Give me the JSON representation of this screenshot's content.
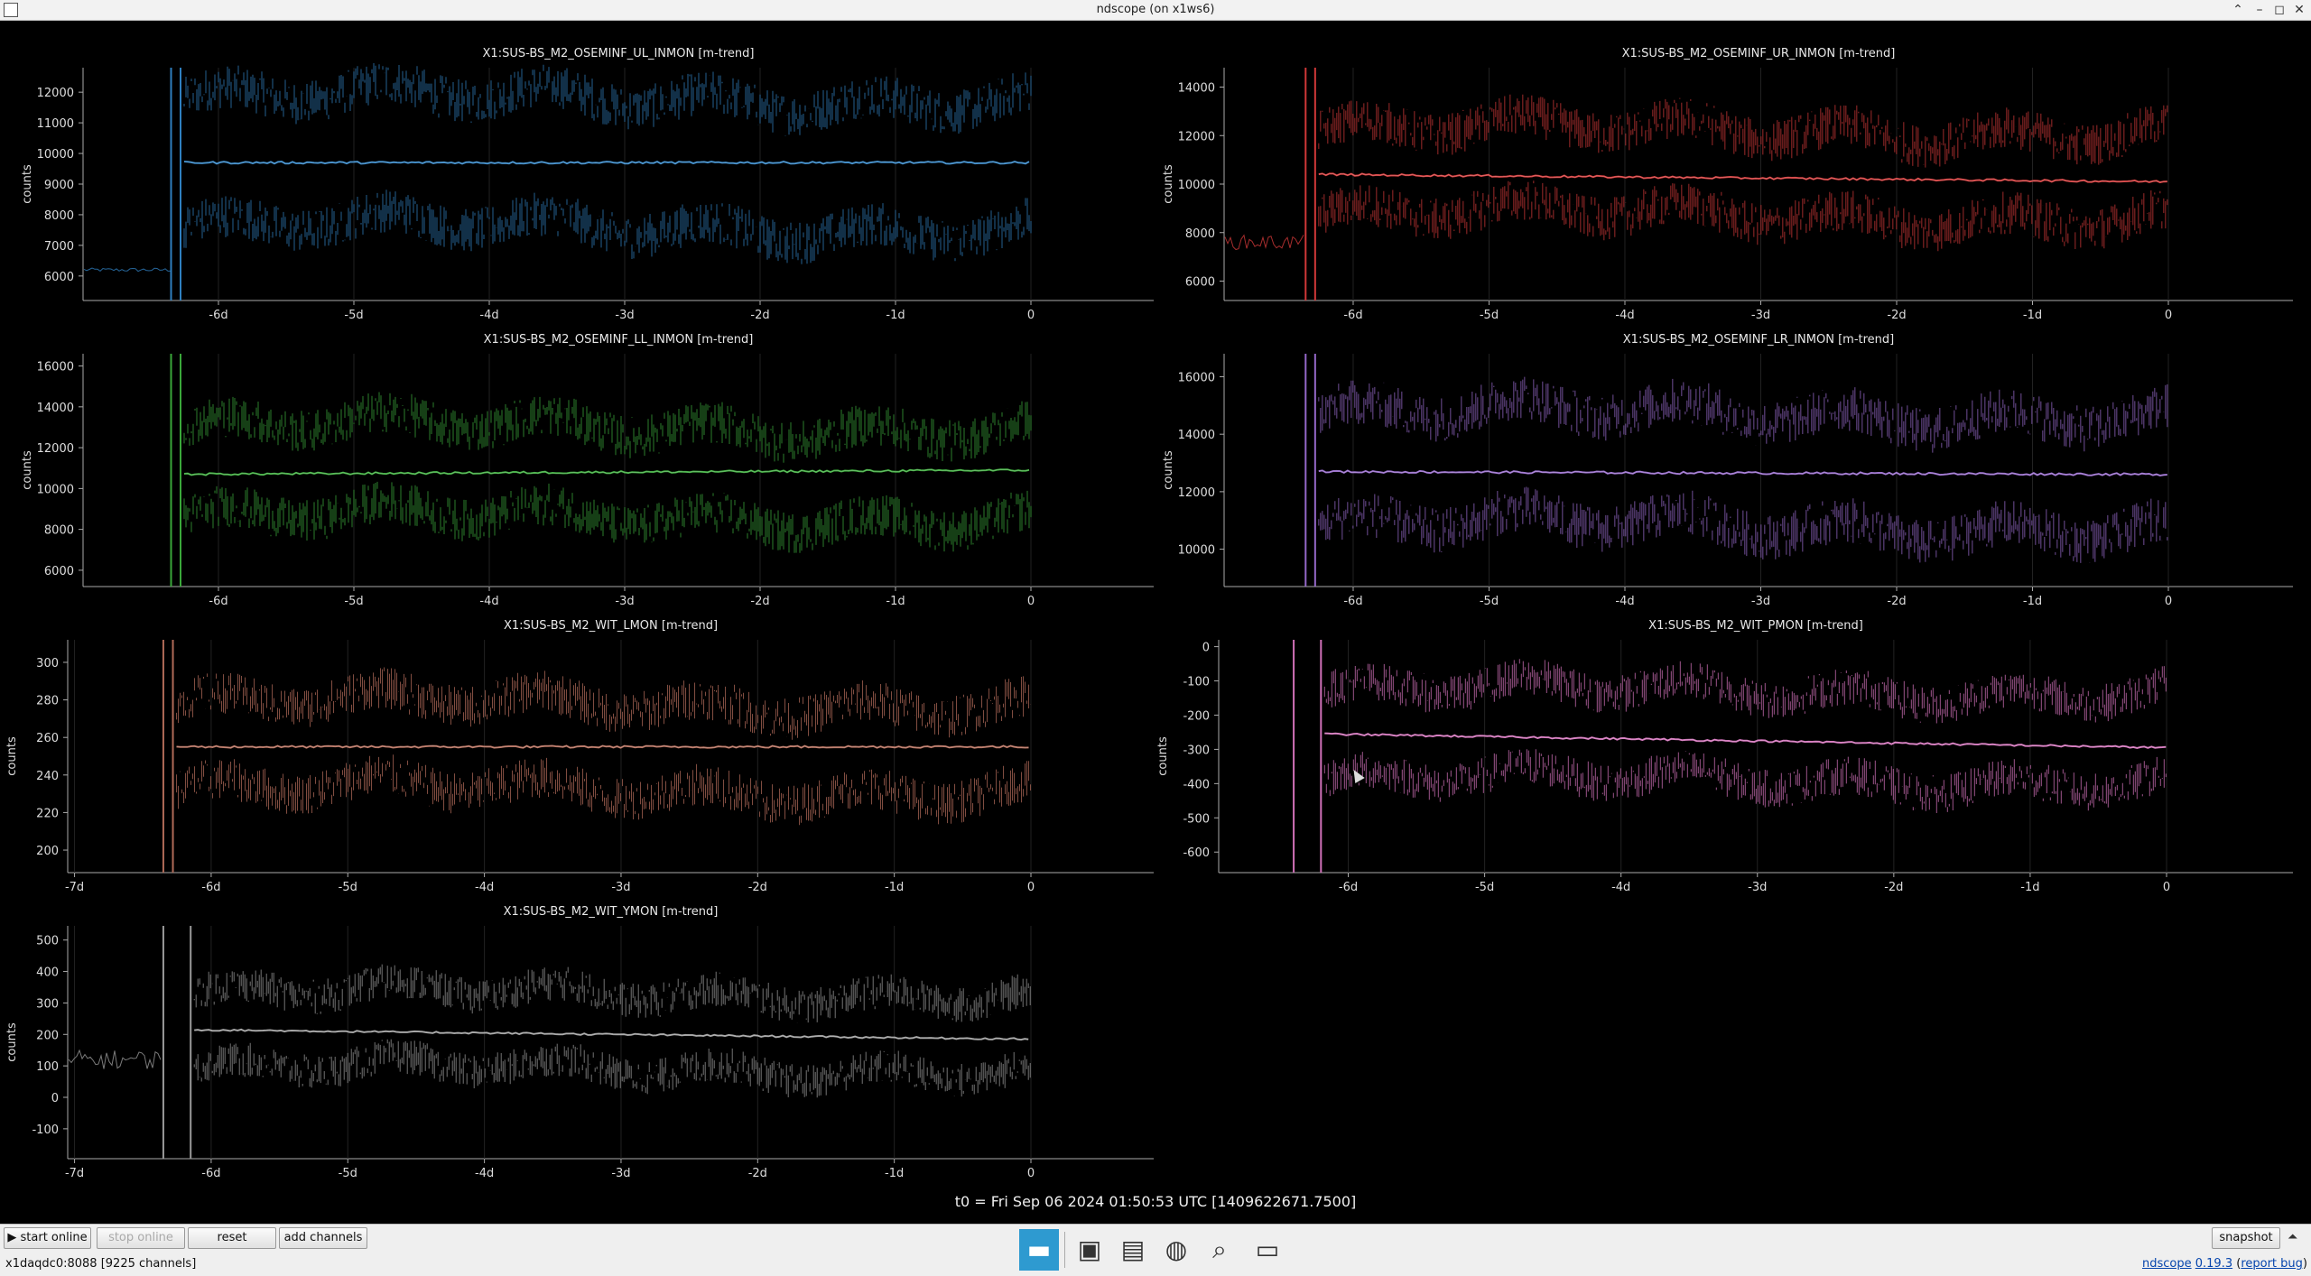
{
  "window": {
    "title": "ndscope (on x1ws6)"
  },
  "plots": [
    {
      "title": "X1:SUS-BS_M2_OSEMINF_UL_INMON [m-trend]",
      "ylabel": "counts",
      "color": "#2f80c0",
      "yticks": [
        6000,
        7000,
        8000,
        9000,
        10000,
        11000,
        12000
      ],
      "ylim": [
        5200,
        12800
      ],
      "xticks": [
        "-6d",
        "-5d",
        "-4d",
        "-3d",
        "-2d",
        "-1d",
        "0"
      ],
      "xstart": -7.0,
      "pre_level": 6200,
      "pre_noise": 120,
      "mean": 9700,
      "mean_drift": 0,
      "upper": 11800,
      "lower": 7600,
      "band": 900,
      "gap": [
        -6.35,
        -6.28
      ]
    },
    {
      "title": "X1:SUS-BS_M2_OSEMINF_UR_INMON [m-trend]",
      "ylabel": "counts",
      "color": "#d03838",
      "yticks": [
        6000,
        8000,
        10000,
        12000,
        14000
      ],
      "ylim": [
        5200,
        14800
      ],
      "xticks": [
        "-6d",
        "-5d",
        "-4d",
        "-3d",
        "-2d",
        "-1d",
        "0"
      ],
      "xstart": -6.95,
      "pre_level": 7600,
      "pre_noise": 600,
      "mean": 10400,
      "mean_drift": -300,
      "upper": 12200,
      "lower": 8700,
      "band": 1100,
      "gap": [
        -6.35,
        -6.28
      ]
    },
    {
      "title": "X1:SUS-BS_M2_OSEMINF_LL_INMON [m-trend]",
      "ylabel": "counts",
      "color": "#3aa83a",
      "yticks": [
        6000,
        8000,
        10000,
        12000,
        14000,
        16000
      ],
      "ylim": [
        5200,
        16600
      ],
      "xticks": [
        "-6d",
        "-5d",
        "-4d",
        "-3d",
        "-2d",
        "-1d",
        "0"
      ],
      "xstart": -7.0,
      "pre_level": null,
      "pre_noise": 0,
      "mean": 10700,
      "mean_drift": 200,
      "upper": 13000,
      "lower": 8600,
      "band": 1300,
      "gap": [
        -6.35,
        -6.28
      ]
    },
    {
      "title": "X1:SUS-BS_M2_OSEMINF_LR_INMON [m-trend]",
      "ylabel": "counts",
      "color": "#9468c8",
      "yticks": [
        10000,
        12000,
        14000,
        16000
      ],
      "ylim": [
        8700,
        16800
      ],
      "xticks": [
        "-6d",
        "-5d",
        "-4d",
        "-3d",
        "-2d",
        "-1d",
        "0"
      ],
      "xstart": -6.95,
      "pre_level": null,
      "pre_noise": 0,
      "mean": 12700,
      "mean_drift": -100,
      "upper": 14700,
      "lower": 10800,
      "band": 1000,
      "gap": [
        -6.35,
        -6.28
      ]
    },
    {
      "title": "X1:SUS-BS_M2_WIT_LMON [m-trend]",
      "ylabel": "counts",
      "color": "#b06a58",
      "yticks": [
        200,
        220,
        240,
        260,
        280,
        300
      ],
      "ylim": [
        188,
        312
      ],
      "xticks": [
        "-7d",
        "-6d",
        "-5d",
        "-4d",
        "-3d",
        "-2d",
        "-1d",
        "0"
      ],
      "xstart": -7.05,
      "pre_level": null,
      "pre_noise": 0,
      "mean": 255,
      "mean_drift": 0,
      "upper": 278,
      "lower": 232,
      "band": 14,
      "gap": [
        -6.35,
        -6.28
      ]
    },
    {
      "title": "X1:SUS-BS_M2_WIT_PMON [m-trend]",
      "ylabel": "counts",
      "color": "#d070b8",
      "yticks": [
        -600,
        -500,
        -400,
        -300,
        -200,
        -100,
        0
      ],
      "ylim": [
        -660,
        20
      ],
      "xticks": [
        "-6d",
        "-5d",
        "-4d",
        "-3d",
        "-2d",
        "-1d",
        "0"
      ],
      "xstart": -6.95,
      "pre_level": null,
      "pre_noise": 0,
      "mean": -255,
      "mean_drift": -40,
      "upper": -130,
      "lower": -390,
      "band": 70,
      "gap": [
        -6.4,
        -6.2
      ]
    },
    {
      "title": "X1:SUS-BS_M2_WIT_YMON [m-trend]",
      "ylabel": "counts",
      "color": "#9a9a9a",
      "yticks": [
        -100,
        0,
        100,
        200,
        300,
        400,
        500
      ],
      "ylim": [
        -195,
        545
      ],
      "xticks": [
        "-7d",
        "-6d",
        "-5d",
        "-4d",
        "-3d",
        "-2d",
        "-1d",
        "0"
      ],
      "xstart": -7.05,
      "pre_level": 120,
      "pre_noise": 60,
      "mean": 215,
      "mean_drift": -30,
      "upper": 330,
      "lower": 90,
      "band": 70,
      "gap": [
        -6.35,
        -6.15
      ]
    }
  ],
  "t0_label": "t0 = Fri Sep 06 2024 01:50:53 UTC [1409622671.7500]",
  "buttons": {
    "start_online": "▶ start online",
    "stop_online": "stop online",
    "reset": "reset",
    "add_channels": "add channels",
    "snapshot": "snapshot"
  },
  "status": "x1daqdc0:8088  [9225 channels]",
  "version": {
    "app": "ndscope",
    "ver": "0.19.3",
    "report": "report bug"
  },
  "taskbar": [
    "app-icon",
    "terminal-icon",
    "notes-icon",
    "browser-icon",
    "search-icon",
    "folder-icon"
  ]
}
